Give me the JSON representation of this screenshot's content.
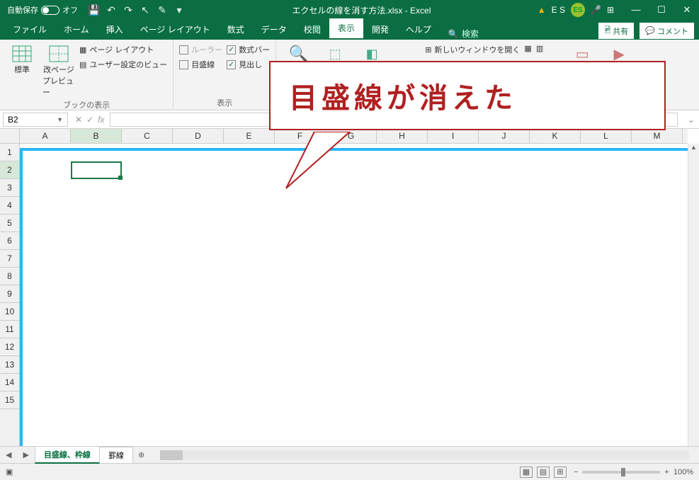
{
  "titlebar": {
    "autosave_label": "自動保存",
    "autosave_state": "オフ",
    "title": "エクセルの線を消す方法.xlsx - Excel",
    "user_initials": "ES",
    "user_text": "E S"
  },
  "tabs": {
    "file": "ファイル",
    "home": "ホーム",
    "insert": "挿入",
    "layout": "ページ レイアウト",
    "formula": "数式",
    "data": "データ",
    "review": "校閲",
    "view": "表示",
    "dev": "開発",
    "help": "ヘルプ",
    "search": "検索",
    "share": "共有",
    "comment": "コメント"
  },
  "ribbon": {
    "group_book": "ブックの表示",
    "group_show": "表示",
    "btn_normal": "標準",
    "btn_pagebreak1": "改ページ",
    "btn_pagebreak2": "プレビュー",
    "btn_pagelayout": "ページ レイアウト",
    "btn_custom": "ユーザー設定のビュー",
    "chk_ruler": "ルーラー",
    "chk_formula": "数式バー",
    "chk_grid": "目盛線",
    "chk_heading": "見出し",
    "btn_newwindow": "新しいウィンドウを開く"
  },
  "formula": {
    "cellref": "B2",
    "fx": "fx"
  },
  "columns": [
    "A",
    "B",
    "C",
    "D",
    "E",
    "F",
    "G",
    "H",
    "I",
    "J",
    "K",
    "L",
    "M"
  ],
  "rows": [
    "1",
    "2",
    "3",
    "4",
    "5",
    "6",
    "7",
    "8",
    "9",
    "10",
    "11",
    "12",
    "13",
    "14",
    "15"
  ],
  "sheettabs": {
    "tab1": "目盛線、枠線",
    "tab2": "罫線"
  },
  "status": {
    "zoom": "100%"
  },
  "callout": {
    "text": "目盛線が消えた"
  }
}
